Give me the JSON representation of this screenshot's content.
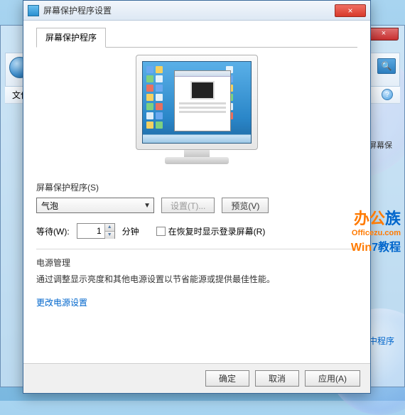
{
  "background": {
    "back_close": "×",
    "menubar_item": "文件",
    "help_glyph": "?",
    "search_glyph": "🔍",
    "side_label1": "屏幕保",
    "side_link1": "中程序"
  },
  "dialog": {
    "title": "屏幕保护程序设置",
    "close_glyph": "×",
    "tab_label": "屏幕保护程序",
    "section_label": "屏幕保护程序(S)",
    "combo_value": "气泡",
    "settings_btn": "设置(T)...",
    "preview_btn": "预览(V)",
    "wait_label": "等待(W):",
    "wait_value": "1",
    "wait_unit": "分钟",
    "resume_checkbox_label": "在恢复时显示登录屏幕(R)",
    "power_heading": "电源管理",
    "power_text": "通过调整显示亮度和其他电源设置以节省能源或提供最佳性能。",
    "power_link": "更改电源设置",
    "ok": "确定",
    "cancel": "取消",
    "apply": "应用(A)"
  },
  "watermark": {
    "line1a": "办公",
    "line1b": "族",
    "line2": "Officezu.com",
    "line3_a": "Win",
    "line3_b": "7教程"
  }
}
